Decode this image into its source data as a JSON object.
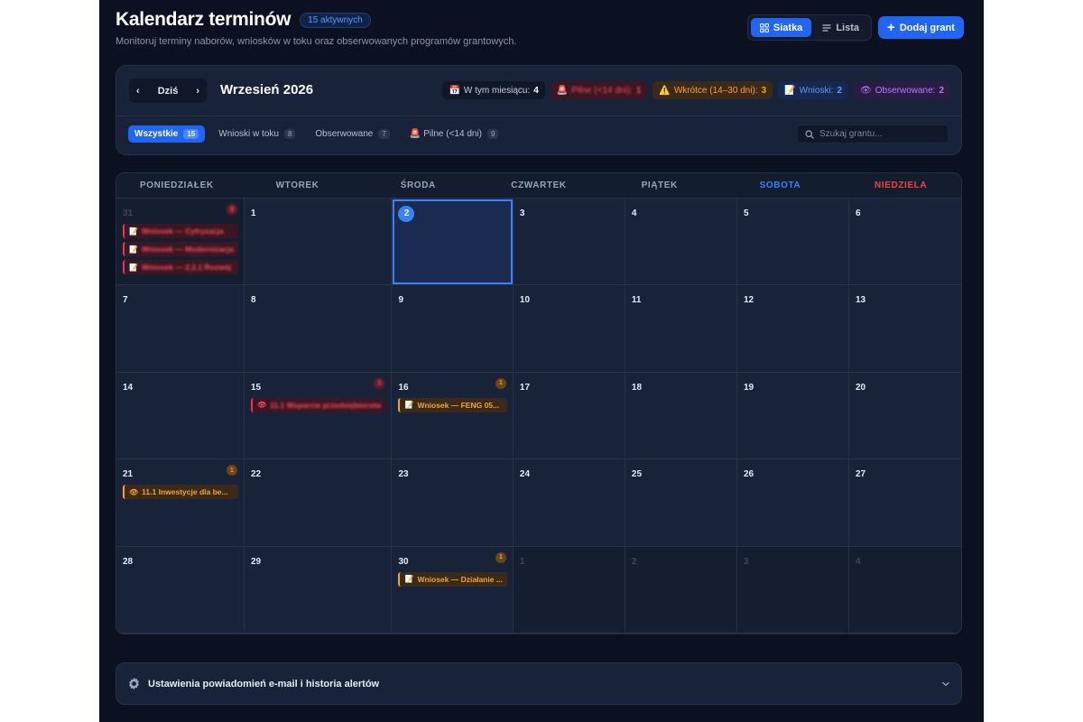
{
  "header": {
    "title": "Kalendarz terminów",
    "active_badge": "15 aktywnych",
    "subtitle": "Monitoruj terminy naborów, wniosków w toku oraz obserwowanych programów grantowych.",
    "view_grid": "Siatka",
    "view_list": "Lista",
    "add_button": "Dodaj grant"
  },
  "toolbar": {
    "today": "Dziś",
    "month_title": "Wrzesień 2026",
    "stats": {
      "this_month_label": "W tym miesiącu:",
      "this_month_value": "4",
      "urgent_label": "Pilne (<14 dni):",
      "urgent_value": "1",
      "soon_label": "Wkrótce (14–30 dni):",
      "soon_value": "3",
      "applications_label": "Wnioski:",
      "applications_value": "2",
      "observed_label": "Obserwowane:",
      "observed_value": "2"
    },
    "filters": [
      {
        "label": "Wszystkie",
        "count": "15"
      },
      {
        "label": "Wnioski w toku",
        "count": "8"
      },
      {
        "label": "Obserwowane",
        "count": "7"
      },
      {
        "label": "Pilne (<14 dni)",
        "count": "9"
      }
    ],
    "search_placeholder": "Szukaj grantu..."
  },
  "calendar": {
    "weekdays": [
      "PONIEDZIAŁEK",
      "WTOREK",
      "ŚRODA",
      "CZWARTEK",
      "PIĄTEK",
      "SOBOTA",
      "NIEDZIELA"
    ],
    "days": [
      {
        "n": "31",
        "other": true,
        "count": "3",
        "count_color": "red",
        "events": [
          {
            "icon": "📝",
            "text": "Wniosek — Cyfryzacja",
            "color": "red"
          },
          {
            "icon": "📝",
            "text": "Wniosek — Modernizacja",
            "color": "red"
          },
          {
            "icon": "📝",
            "text": "Wniosek — 2.2.1 Rozwój",
            "color": "red"
          }
        ]
      },
      {
        "n": "1"
      },
      {
        "n": "2",
        "today": true
      },
      {
        "n": "3"
      },
      {
        "n": "4"
      },
      {
        "n": "5"
      },
      {
        "n": "6"
      },
      {
        "n": "7"
      },
      {
        "n": "8"
      },
      {
        "n": "9"
      },
      {
        "n": "10"
      },
      {
        "n": "11"
      },
      {
        "n": "12"
      },
      {
        "n": "13"
      },
      {
        "n": "14"
      },
      {
        "n": "15",
        "count": "1",
        "count_color": "red",
        "events": [
          {
            "icon": "👁",
            "text": "11.1 Wsparcie przedsiębiorstw",
            "color": "red"
          }
        ]
      },
      {
        "n": "16",
        "count": "1",
        "count_color": "orange",
        "events": [
          {
            "icon": "📝",
            "text": "Wniosek — FENG 05...",
            "color": "orange"
          }
        ]
      },
      {
        "n": "17"
      },
      {
        "n": "18"
      },
      {
        "n": "19"
      },
      {
        "n": "20"
      },
      {
        "n": "21",
        "count": "1",
        "count_color": "orange",
        "events": [
          {
            "icon": "👁",
            "text": "11.1 Inwestycje dla be...",
            "color": "orange"
          }
        ]
      },
      {
        "n": "22"
      },
      {
        "n": "23"
      },
      {
        "n": "24"
      },
      {
        "n": "25"
      },
      {
        "n": "26"
      },
      {
        "n": "27"
      },
      {
        "n": "28"
      },
      {
        "n": "29"
      },
      {
        "n": "30",
        "count": "1",
        "count_color": "orange",
        "events": [
          {
            "icon": "📝",
            "text": "Wniosek — Działanie ...",
            "color": "orange"
          }
        ]
      },
      {
        "n": "1",
        "other": true
      },
      {
        "n": "2",
        "other": true
      },
      {
        "n": "3",
        "other": true
      },
      {
        "n": "4",
        "other": true
      }
    ]
  },
  "settings": {
    "label": "Ustawienia powiadomień e-mail i historia alertów"
  }
}
